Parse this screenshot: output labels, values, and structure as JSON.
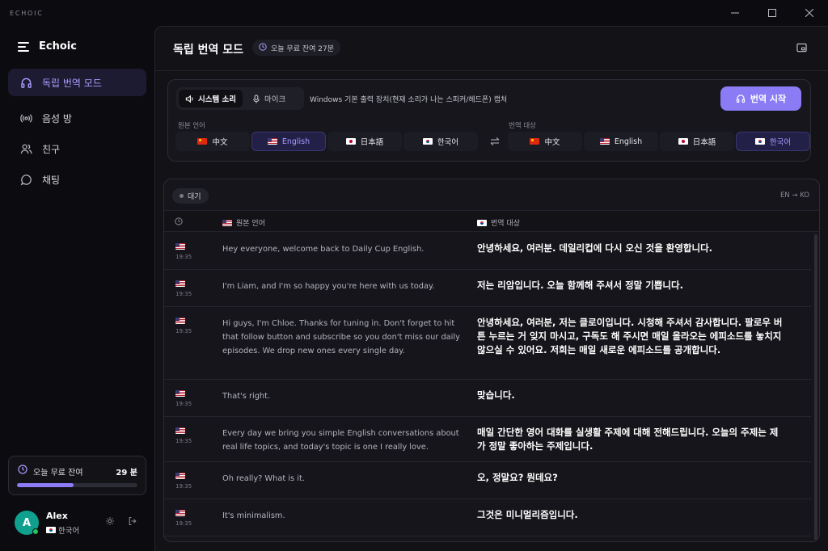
{
  "app": {
    "window_tag": "ECHOIC",
    "brand": "Echoic"
  },
  "window_controls": {
    "minimize": "—",
    "maximize": "☐",
    "close": "✕"
  },
  "sidebar": {
    "items": [
      {
        "label": "독립 번역 모드",
        "icon": "headphones-icon",
        "active": true
      },
      {
        "label": "음성 방",
        "icon": "broadcast-icon",
        "active": false
      },
      {
        "label": "친구",
        "icon": "users-icon",
        "active": false
      },
      {
        "label": "채팅",
        "icon": "chat-bubble-icon",
        "active": false
      }
    ],
    "quota": {
      "label": "오늘 무료 잔여",
      "value": "29 분",
      "progress_percent": 47
    },
    "user": {
      "initial": "A",
      "name": "Alex",
      "language": "한국어",
      "online": true
    }
  },
  "header": {
    "title": "독립 번역 모드",
    "remaining": "오늘 무료 잔여 27분"
  },
  "controls": {
    "source_tabs": [
      "시스템 소리",
      "마이크"
    ],
    "source_selected": 0,
    "source_description": "Windows 기본 출력 장치(현재 소리가 나는 스피커/헤드폰) 캡처",
    "start_button": "번역 시작",
    "source_language_label": "원본 언어",
    "target_language_label": "번역 대상",
    "languages": [
      {
        "label": "中文",
        "flag": "cn"
      },
      {
        "label": "English",
        "flag": "us"
      },
      {
        "label": "日本語",
        "flag": "jp"
      },
      {
        "label": "한국어",
        "flag": "kr"
      }
    ],
    "source_selected_language": "English",
    "target_selected_language": "한국어",
    "accent_color": "#8b7cf6"
  },
  "transcript": {
    "status": "대기",
    "direction": "EN → KO",
    "columns": {
      "source": "원본 언어",
      "target": "번역 대상"
    },
    "rows": [
      {
        "time": "19:35",
        "source": "Hey everyone, welcome back to Daily Cup English.",
        "target": "안녕하세요, 여러분. 데일리컵에 다시 오신 것을 환영합니다."
      },
      {
        "time": "19:35",
        "source": "I'm Liam, and I'm so happy you're here with us today.",
        "target": "저는 리암입니다. 오늘 함께해 주셔서 정말 기쁩니다."
      },
      {
        "time": "19:35",
        "source": "Hi guys, I'm Chloe. Thanks for tuning in. Don't forget to hit that follow button and subscribe so you don't miss our daily episodes. We drop new ones every single day.",
        "target": "안녕하세요, 여러분, 저는 클로이입니다. 시청해 주셔서 감사합니다. 팔로우 버튼 누르는 거 잊지 마시고, 구독도 해 주시면 매일 올라오는 에피소드를 놓치지 않으실 수 있어요. 저희는 매일 새로운 에피소드를 공개합니다."
      },
      {
        "time": "19:35",
        "source": "That's right.",
        "target": "맞습니다."
      },
      {
        "time": "19:35",
        "source": "Every day we bring you simple English conversations about real life topics, and today's topic is one I really love.",
        "target": "매일 간단한 영어 대화를 실생활 주제에 대해 전해드립니다. 오늘의 주제는 제가 정말 좋아하는 주제입니다."
      },
      {
        "time": "19:35",
        "source": "Oh really? What is it.",
        "target": "오, 정말요? 뭔데요?"
      },
      {
        "time": "19:35",
        "source": "It's minimalism.",
        "target": "그것은 미니멀리즘입니다."
      }
    ]
  }
}
